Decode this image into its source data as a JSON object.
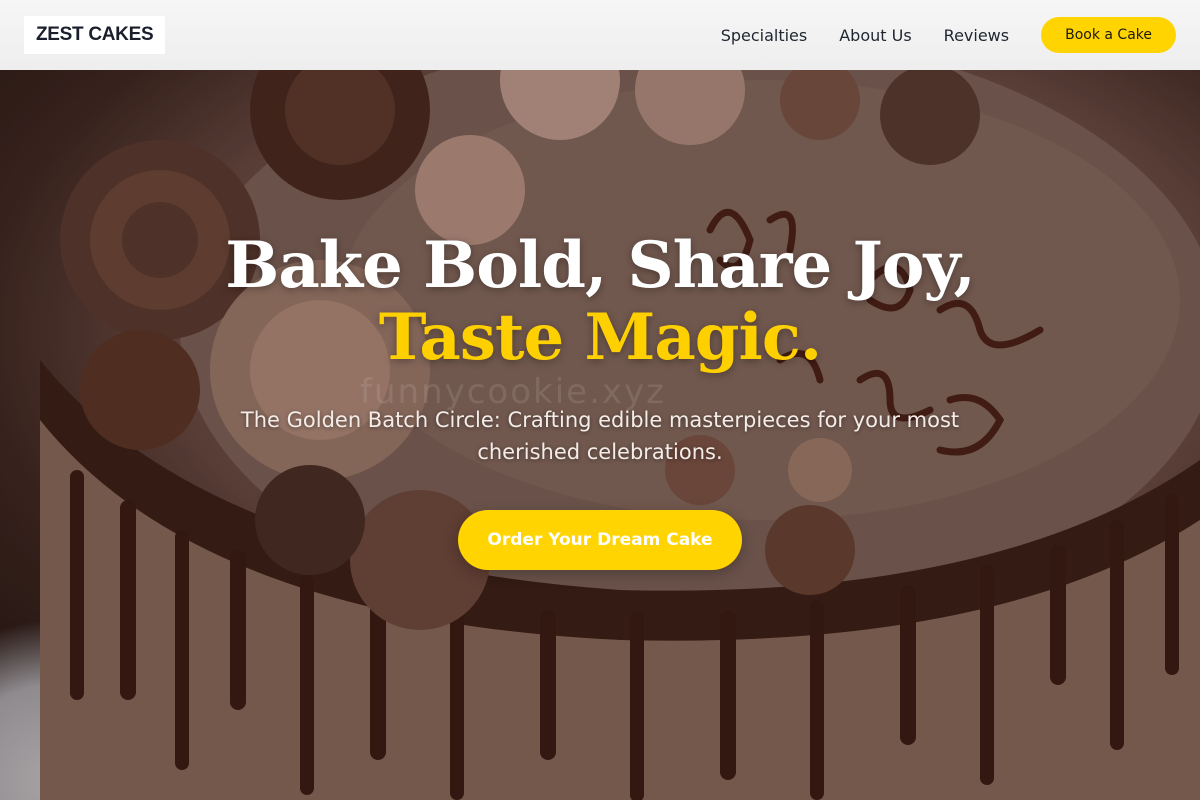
{
  "header": {
    "logo": "ZEST CAKES",
    "nav": [
      {
        "label": "Specialties"
      },
      {
        "label": "About Us"
      },
      {
        "label": "Reviews"
      }
    ],
    "cta": "Book a Cake"
  },
  "hero": {
    "title_line1": "Bake Bold, Share Joy,",
    "title_line2": "Taste Magic.",
    "subtitle": "The Golden Batch Circle: Crafting edible masterpieces for your most cherished celebrations.",
    "cta": "Order Your Dream Cake",
    "watermark": "funnycookie.xyz"
  },
  "colors": {
    "accent": "#ffd400",
    "header_bg": "#f3f3f3",
    "text_dark": "#1f2630"
  }
}
